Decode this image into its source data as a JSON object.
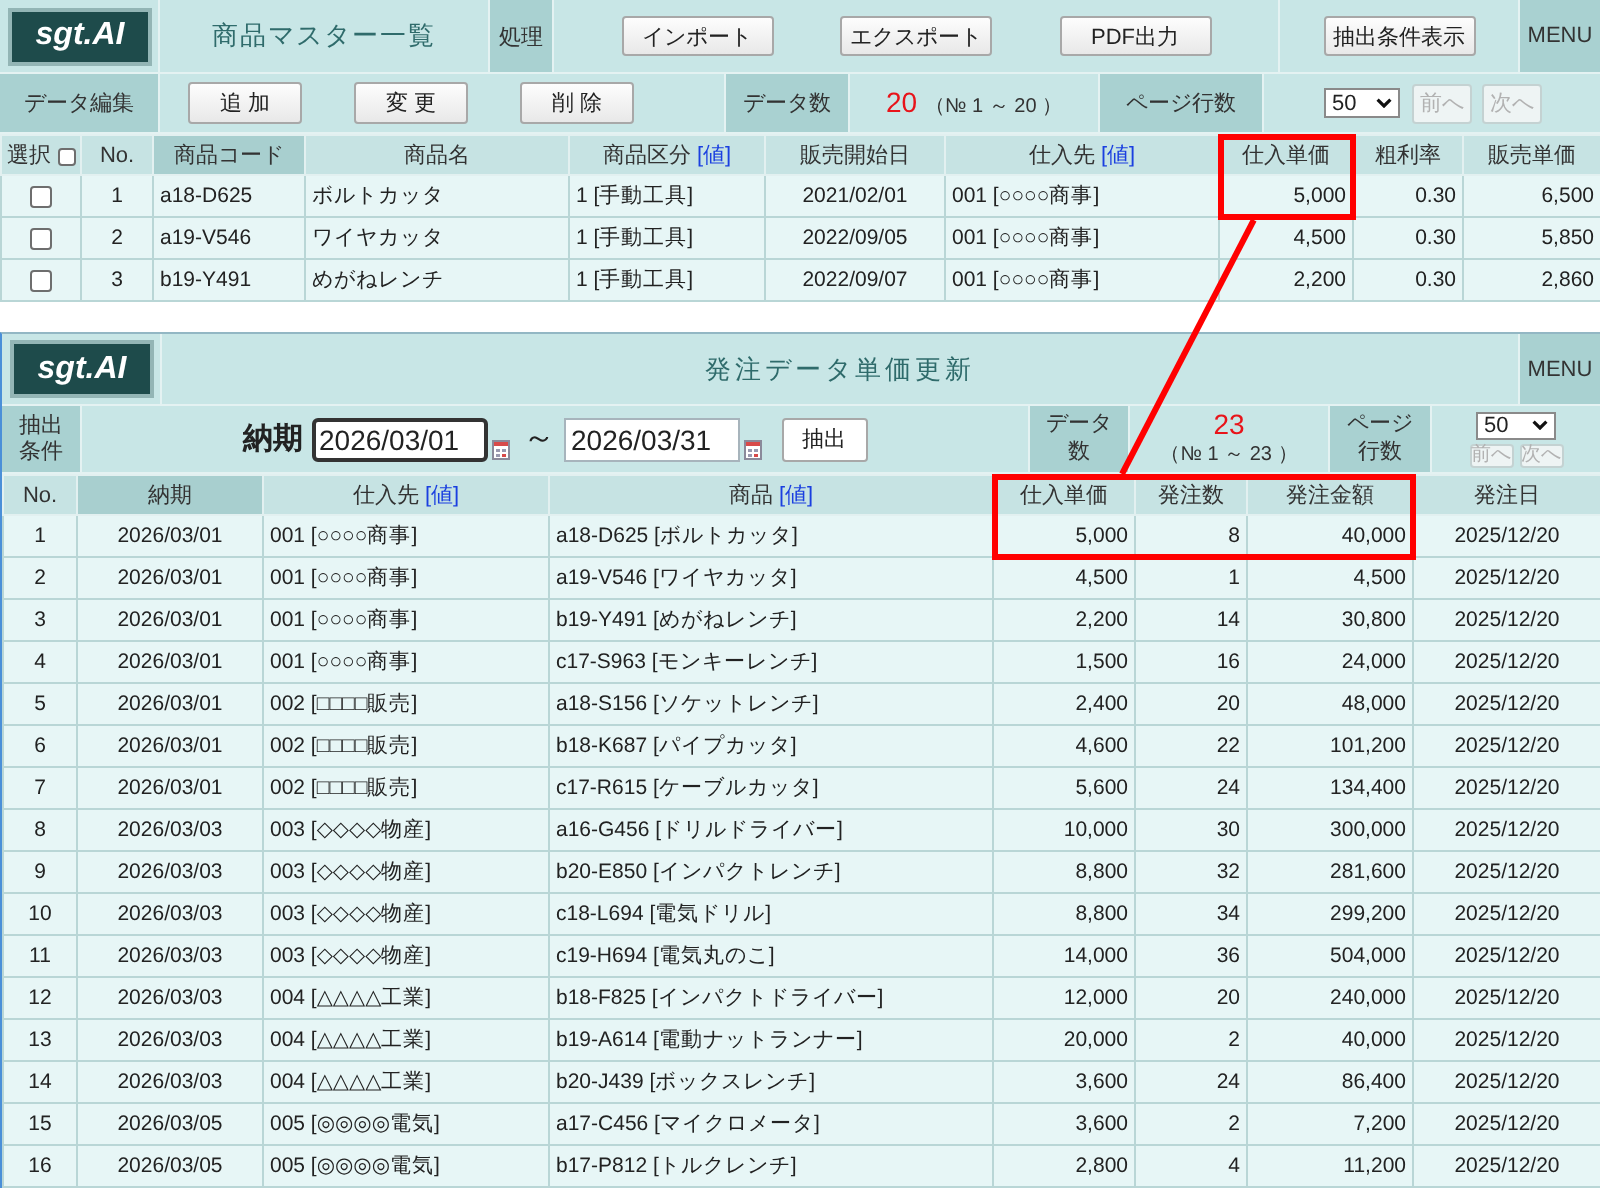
{
  "master": {
    "logo": "sgt.AI",
    "title": "商品マスター一覧",
    "process_label": "処理",
    "process_buttons": [
      "インポート",
      "エクスポート",
      "PDF出力"
    ],
    "filter_button": "抽出条件表示",
    "menu": "MENU",
    "edit_label": "データ編集",
    "edit_buttons": [
      "追 加",
      "変 更",
      "削 除"
    ],
    "count_label": "データ数",
    "count": "20",
    "range": "（№ 1 ～ 20 ）",
    "page_rows_label": "ページ行数",
    "page_rows": "50",
    "pager": [
      {
        "label": "前へ",
        "disabled": true
      },
      {
        "label": "次へ",
        "disabled": true
      }
    ],
    "table": {
      "select_column": {
        "label": "選択",
        "checked": false
      },
      "columns": [
        {
          "label": "No.",
          "kind": "center",
          "sorted": false,
          "highlighted": false
        },
        {
          "label": "商品コード",
          "kind": "text",
          "sorted": true,
          "highlighted": false
        },
        {
          "label": "商品名",
          "kind": "text",
          "sorted": false,
          "highlighted": false
        },
        {
          "label": "商品区分",
          "link": "[値]",
          "kind": "text",
          "sorted": false,
          "highlighted": false
        },
        {
          "label": "販売開始日",
          "kind": "center",
          "sorted": false,
          "highlighted": false
        },
        {
          "label": "仕入先",
          "link": "[値]",
          "kind": "text",
          "sorted": false,
          "highlighted": false
        },
        {
          "label": "仕入単価",
          "kind": "number",
          "sorted": false,
          "highlighted": true
        },
        {
          "label": "粗利率",
          "kind": "number",
          "sorted": false,
          "highlighted": false
        },
        {
          "label": "販売単価",
          "kind": "number",
          "sorted": false,
          "highlighted": false
        }
      ],
      "rows": [
        {
          "checked": false,
          "highlighted": true,
          "cells": [
            "1",
            "a18-D625",
            "ボルトカッタ",
            "1 [手動工具]",
            "2021/02/01",
            "001 [○○○○商事]",
            "5,000",
            "0.30",
            "6,500"
          ]
        },
        {
          "checked": false,
          "highlighted": false,
          "cells": [
            "2",
            "a19-V546",
            "ワイヤカッタ",
            "1 [手動工具]",
            "2022/09/05",
            "001 [○○○○商事]",
            "4,500",
            "0.30",
            "5,850"
          ]
        },
        {
          "checked": false,
          "highlighted": false,
          "cells": [
            "3",
            "b19-Y491",
            "めがねレンチ",
            "1 [手動工具]",
            "2022/09/07",
            "001 [○○○○商事]",
            "2,200",
            "0.30",
            "2,860"
          ]
        }
      ]
    }
  },
  "order": {
    "logo": "sgt.AI",
    "title": "発注データ単価更新",
    "menu": "MENU",
    "filter_label": "抽出条件",
    "date_label": "納期",
    "date_fields": [
      {
        "value": "2026/03/01",
        "focused": true
      },
      {
        "value": "2026/03/31",
        "focused": false
      }
    ],
    "range_sep": "～",
    "extract_button": "抽出",
    "count_label": "データ数",
    "count": "23",
    "range": "（№ 1 ～ 23 ）",
    "page_rows_label": "ページ行数",
    "page_rows": "50",
    "pager": [
      {
        "label": "前へ",
        "disabled": true
      },
      {
        "label": "次へ",
        "disabled": true
      }
    ],
    "table": {
      "columns": [
        {
          "label": "No.",
          "kind": "center",
          "sorted": false,
          "highlighted": false
        },
        {
          "label": "納期",
          "kind": "center",
          "sorted": true,
          "highlighted": false
        },
        {
          "label": "仕入先",
          "link": "[値]",
          "kind": "text",
          "sorted": false,
          "highlighted": false
        },
        {
          "label": "商品",
          "link": "[値]",
          "kind": "text",
          "sorted": false,
          "highlighted": false
        },
        {
          "label": "仕入単価",
          "kind": "number",
          "sorted": false,
          "highlighted": true
        },
        {
          "label": "発注数",
          "kind": "number",
          "sorted": false,
          "highlighted": true
        },
        {
          "label": "発注金額",
          "kind": "number",
          "sorted": false,
          "highlighted": true
        },
        {
          "label": "発注日",
          "kind": "center",
          "sorted": false,
          "highlighted": false
        }
      ],
      "rows": [
        {
          "highlighted": true,
          "cells": [
            "1",
            "2026/03/01",
            "001 [○○○○商事]",
            "a18-D625 [ボルトカッタ]",
            "5,000",
            "8",
            "40,000",
            "2025/12/20"
          ]
        },
        {
          "highlighted": false,
          "cells": [
            "2",
            "2026/03/01",
            "001 [○○○○商事]",
            "a19-V546 [ワイヤカッタ]",
            "4,500",
            "1",
            "4,500",
            "2025/12/20"
          ]
        },
        {
          "highlighted": false,
          "cells": [
            "3",
            "2026/03/01",
            "001 [○○○○商事]",
            "b19-Y491 [めがねレンチ]",
            "2,200",
            "14",
            "30,800",
            "2025/12/20"
          ]
        },
        {
          "highlighted": false,
          "cells": [
            "4",
            "2026/03/01",
            "001 [○○○○商事]",
            "c17-S963 [モンキーレンチ]",
            "1,500",
            "16",
            "24,000",
            "2025/12/20"
          ]
        },
        {
          "highlighted": false,
          "cells": [
            "5",
            "2026/03/01",
            "002 [□□□□販売]",
            "a18-S156 [ソケットレンチ]",
            "2,400",
            "20",
            "48,000",
            "2025/12/20"
          ]
        },
        {
          "highlighted": false,
          "cells": [
            "6",
            "2026/03/01",
            "002 [□□□□販売]",
            "b18-K687 [パイプカッタ]",
            "4,600",
            "22",
            "101,200",
            "2025/12/20"
          ]
        },
        {
          "highlighted": false,
          "cells": [
            "7",
            "2026/03/01",
            "002 [□□□□販売]",
            "c17-R615 [ケーブルカッタ]",
            "5,600",
            "24",
            "134,400",
            "2025/12/20"
          ]
        },
        {
          "highlighted": false,
          "cells": [
            "8",
            "2026/03/03",
            "003 [◇◇◇◇物産]",
            "a16-G456 [ドリルドライバー]",
            "10,000",
            "30",
            "300,000",
            "2025/12/20"
          ]
        },
        {
          "highlighted": false,
          "cells": [
            "9",
            "2026/03/03",
            "003 [◇◇◇◇物産]",
            "b20-E850 [インパクトレンチ]",
            "8,800",
            "32",
            "281,600",
            "2025/12/20"
          ]
        },
        {
          "highlighted": false,
          "cells": [
            "10",
            "2026/03/03",
            "003 [◇◇◇◇物産]",
            "c18-L694 [電気ドリル]",
            "8,800",
            "34",
            "299,200",
            "2025/12/20"
          ]
        },
        {
          "highlighted": false,
          "cells": [
            "11",
            "2026/03/03",
            "003 [◇◇◇◇物産]",
            "c19-H694 [電気丸のこ]",
            "14,000",
            "36",
            "504,000",
            "2025/12/20"
          ]
        },
        {
          "highlighted": false,
          "cells": [
            "12",
            "2026/03/03",
            "004 [△△△△工業]",
            "b18-F825 [インパクトドライバー]",
            "12,000",
            "20",
            "240,000",
            "2025/12/20"
          ]
        },
        {
          "highlighted": false,
          "cells": [
            "13",
            "2026/03/03",
            "004 [△△△△工業]",
            "b19-A614 [電動ナットランナー]",
            "20,000",
            "2",
            "40,000",
            "2025/12/20"
          ]
        },
        {
          "highlighted": false,
          "cells": [
            "14",
            "2026/03/03",
            "004 [△△△△工業]",
            "b20-J439 [ボックスレンチ]",
            "3,600",
            "24",
            "86,400",
            "2025/12/20"
          ]
        },
        {
          "highlighted": false,
          "cells": [
            "15",
            "2026/03/05",
            "005 [◎◎◎◎電気]",
            "a17-C456 [マイクロメータ]",
            "3,600",
            "2",
            "7,200",
            "2025/12/20"
          ]
        },
        {
          "highlighted": false,
          "cells": [
            "16",
            "2026/03/05",
            "005 [◎◎◎◎電気]",
            "b17-P812 [トルクレンチ]",
            "2,800",
            "4",
            "11,200",
            "2025/12/20"
          ]
        }
      ]
    }
  },
  "callout_line": true
}
